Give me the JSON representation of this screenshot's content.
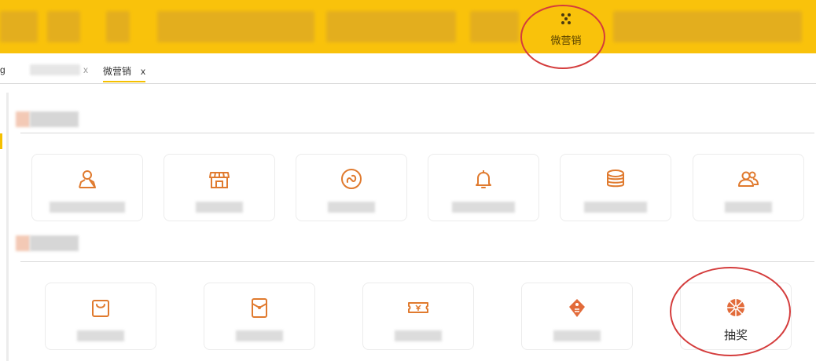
{
  "header": {
    "active_item": {
      "label": "微营销",
      "icon": "dots-icon"
    }
  },
  "tabs": {
    "first_prefix": "g",
    "first_close": "x",
    "active_label": "微营销",
    "active_close": "x"
  },
  "sections": [
    {
      "cards": [
        {
          "icon": "user-icon"
        },
        {
          "icon": "store-icon"
        },
        {
          "icon": "mini-program-icon"
        },
        {
          "icon": "bell-icon"
        },
        {
          "icon": "coins-icon"
        },
        {
          "icon": "users-icon"
        }
      ]
    },
    {
      "cards": [
        {
          "icon": "shopping-bag-icon"
        },
        {
          "icon": "red-envelope-icon"
        },
        {
          "icon": "coupon-icon"
        },
        {
          "icon": "price-tag-icon"
        },
        {
          "icon": "lottery-wheel-icon",
          "label": "抽奖"
        }
      ]
    }
  ],
  "colors": {
    "header": "#f9c20b",
    "accent": "#f5c000",
    "icon": "#e07a2e",
    "annotation": "#d43c3c"
  }
}
